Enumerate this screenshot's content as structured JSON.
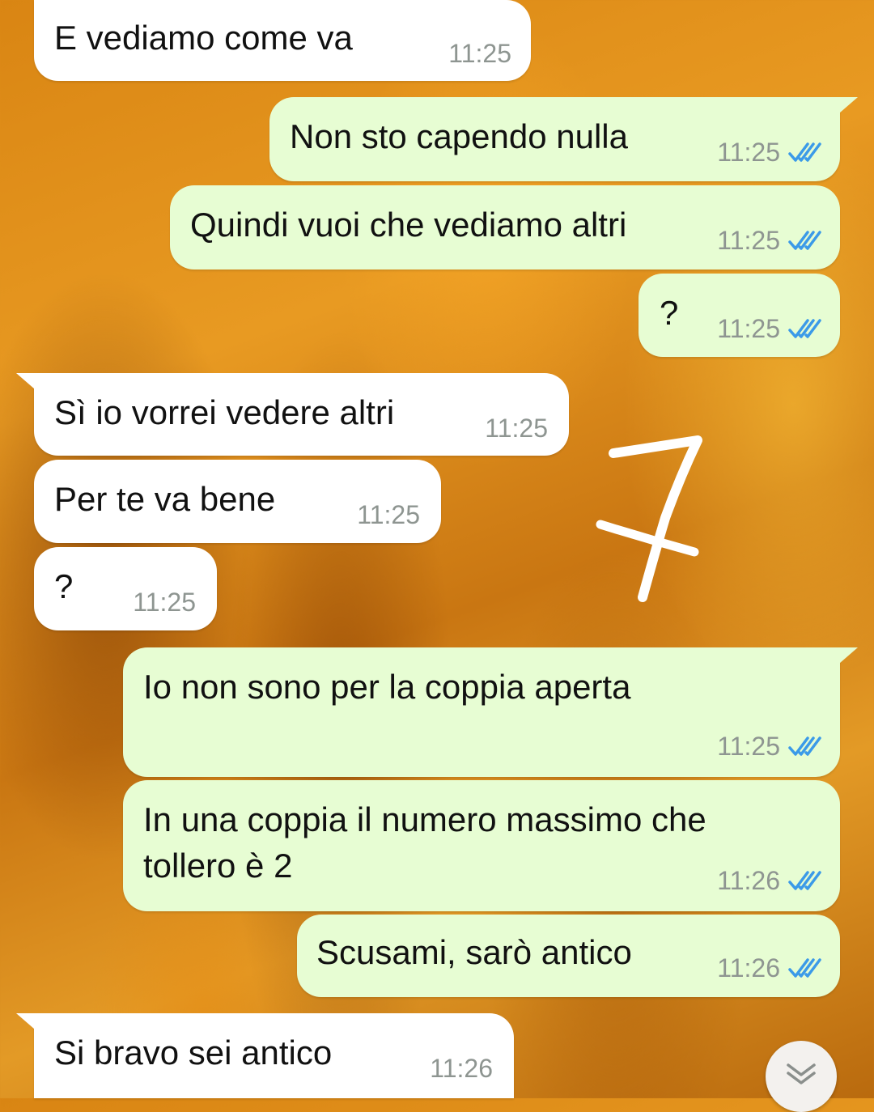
{
  "chat": {
    "messages": [
      {
        "direction": "incoming",
        "text": "E vediamo come va",
        "time": "11:25"
      },
      {
        "direction": "outgoing",
        "text": "Non sto capendo nulla",
        "time": "11:25",
        "status": "read"
      },
      {
        "direction": "outgoing",
        "text": "Quindi vuoi che vediamo altri",
        "time": "11:25",
        "status": "read"
      },
      {
        "direction": "outgoing",
        "text": "?",
        "time": "11:25",
        "status": "read"
      },
      {
        "direction": "incoming",
        "text": "Sì io vorrei vedere altri",
        "time": "11:25"
      },
      {
        "direction": "incoming",
        "text": "Per te va bene",
        "time": "11:25"
      },
      {
        "direction": "incoming",
        "text": "?",
        "time": "11:25"
      },
      {
        "direction": "outgoing",
        "text": "Io non sono per la coppia aperta",
        "time": "11:25",
        "status": "read"
      },
      {
        "direction": "outgoing",
        "text_line1": "In una coppia il numero massimo che",
        "text_line2": "tollero è 2",
        "time": "11:26",
        "status": "read"
      },
      {
        "direction": "outgoing",
        "text": "Scusami, sarò antico",
        "time": "11:26",
        "status": "read"
      },
      {
        "direction": "incoming",
        "text": "Si bravo sei antico",
        "time": "11:26"
      }
    ]
  },
  "colors": {
    "incoming_bubble": "#ffffff",
    "outgoing_bubble": "#e7fdd3",
    "read_ticks": "#3b9ae8",
    "timestamp": "#8e9591"
  },
  "icons": {
    "read_receipt": "double-check-icon",
    "scroll_down": "double-chevron-down-icon",
    "annotation": "handwritten-7-scribble"
  }
}
